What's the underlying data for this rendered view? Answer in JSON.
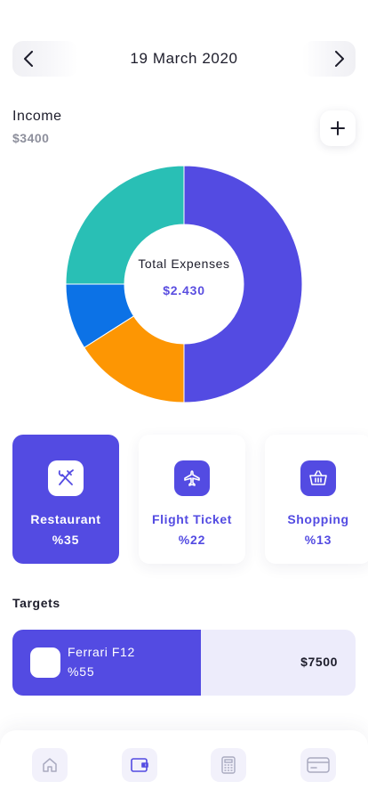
{
  "header": {
    "date": "19 March 2020",
    "prev_icon": "chevron-left-icon",
    "next_icon": "chevron-right-icon"
  },
  "income": {
    "label": "Income",
    "value": "$3400",
    "add_icon": "plus-icon"
  },
  "expenses": {
    "label": "Total Expenses",
    "value": "$2.430"
  },
  "chart_data": {
    "type": "pie",
    "donut": true,
    "title": "",
    "slices": [
      {
        "value": 50,
        "color": "#534be2"
      },
      {
        "value": 16,
        "color": "#fd9603"
      },
      {
        "value": 9,
        "color": "#0c72e6"
      },
      {
        "value": 25,
        "color": "#29bfb5"
      }
    ],
    "center_label": "Total Expenses",
    "center_value": "$2.430"
  },
  "categories": [
    {
      "name": "Restaurant",
      "percent": "%35",
      "icon": "fork-knife-icon",
      "active": true
    },
    {
      "name": "Flight Ticket",
      "percent": "%22",
      "icon": "airplane-icon",
      "active": false
    },
    {
      "name": "Shopping",
      "percent": "%13",
      "icon": "basket-icon",
      "active": false
    }
  ],
  "targets": {
    "title": "Targets",
    "items": [
      {
        "name": "Ferrari F12",
        "percent": "%55",
        "progress": 0.55,
        "amount": "$7500"
      }
    ]
  },
  "tabbar": {
    "items": [
      "home-icon",
      "wallet-icon",
      "calculator-icon",
      "card-icon"
    ]
  },
  "colors": {
    "accent": "#534be2",
    "orange": "#fd9603",
    "blue": "#0c72e6",
    "teal": "#29bfb5",
    "muted": "#8d8f9c",
    "track": "#edecfb"
  }
}
